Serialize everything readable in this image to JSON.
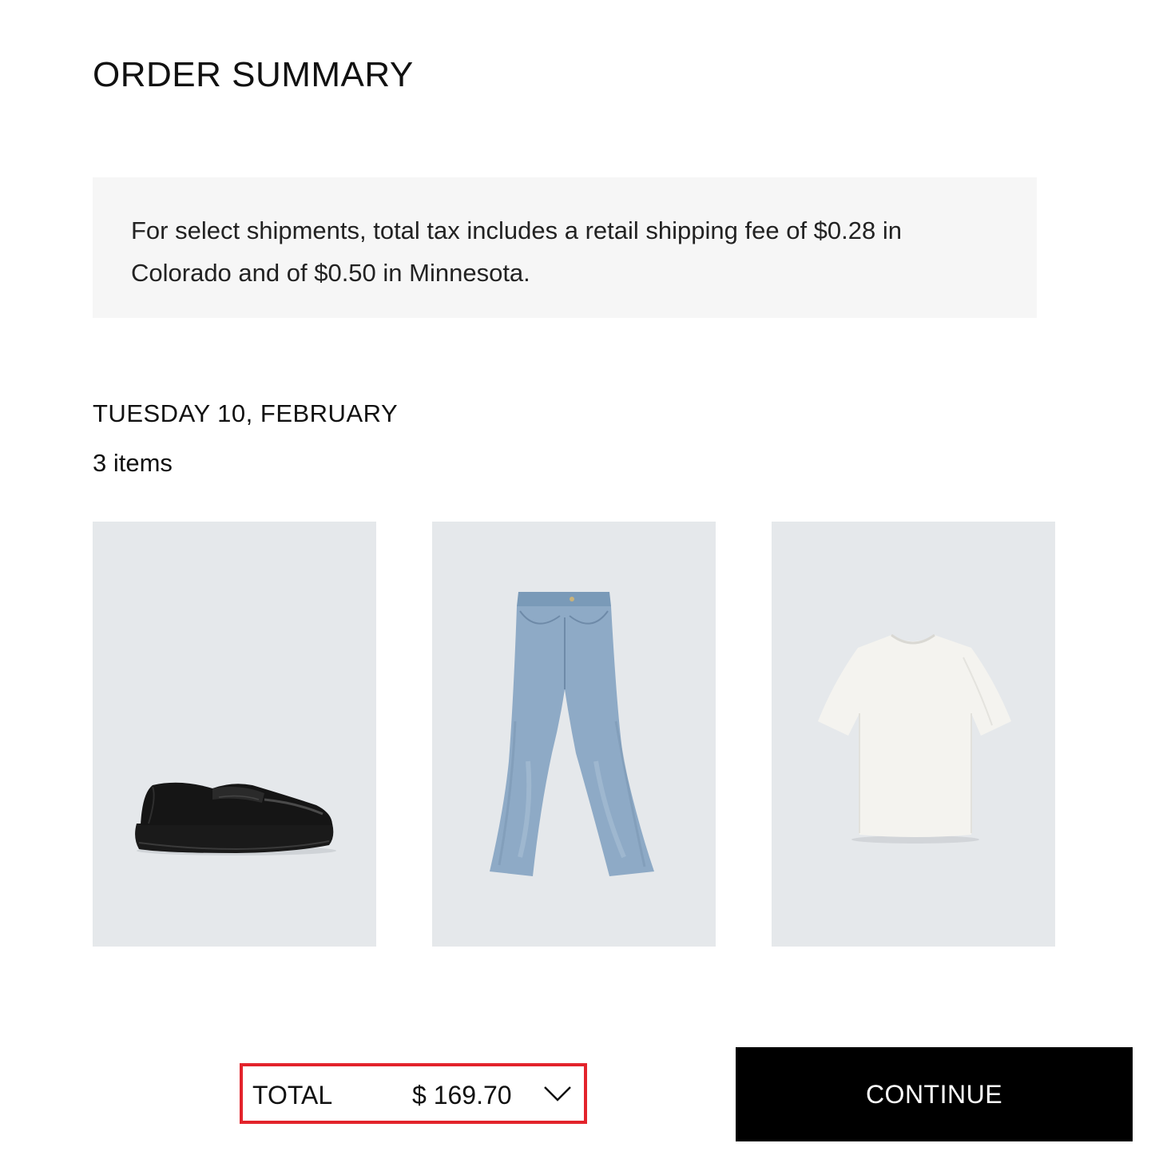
{
  "header": {
    "title": "ORDER SUMMARY"
  },
  "notice": {
    "text": "For select shipments, total tax includes a retail shipping fee of $0.28 in Colorado and of $0.50 in Minnesota."
  },
  "shipment": {
    "date": "TUESDAY 10, FEBRUARY",
    "item_count": "3 items",
    "items": [
      {
        "icon": "black-loafer-image"
      },
      {
        "icon": "blue-jeans-image"
      },
      {
        "icon": "white-tshirt-image"
      }
    ]
  },
  "footer": {
    "total_label": "TOTAL",
    "total_value": "$ 169.70",
    "continue_label": "CONTINUE",
    "highlight_color": "#e3232b",
    "button_color": "#000000"
  }
}
